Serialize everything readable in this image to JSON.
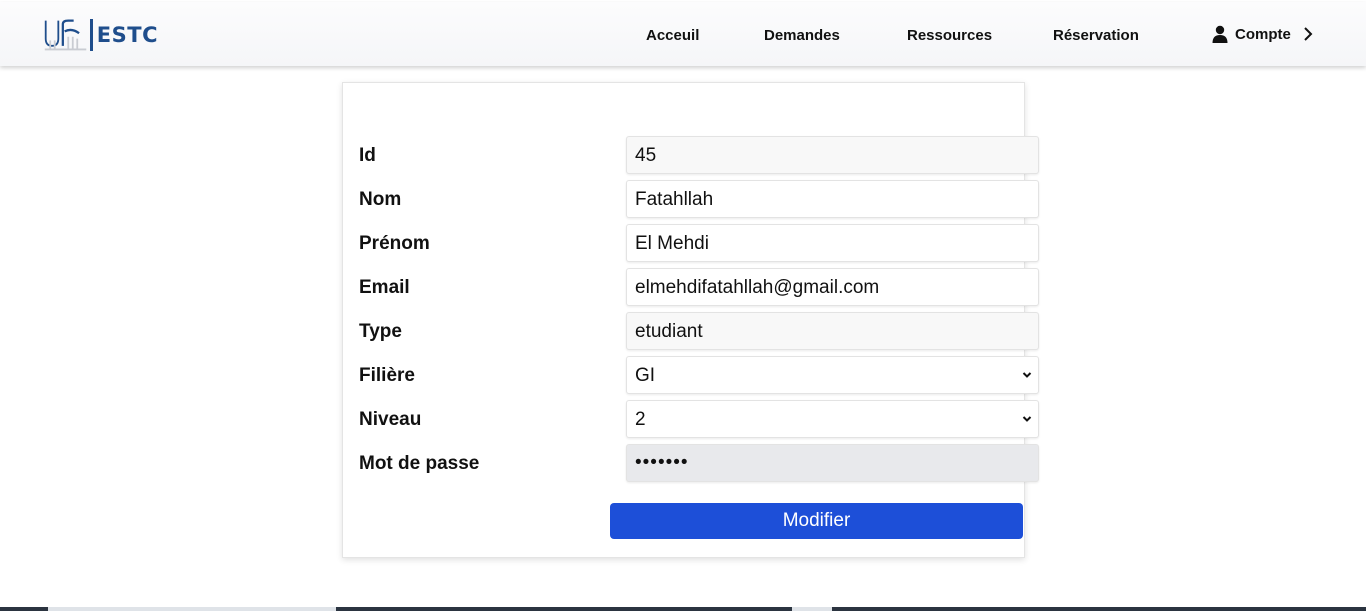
{
  "header": {
    "logo_text": "ESTC",
    "nav": [
      "Acceuil",
      "Demandes",
      "Ressources",
      "Réservation"
    ],
    "account_label": "Compte"
  },
  "form": {
    "fields": [
      {
        "label": "Id",
        "value": "45"
      },
      {
        "label": "Nom",
        "value": "Fatahllah"
      },
      {
        "label": "Prénom",
        "value": "El Mehdi"
      },
      {
        "label": "Email",
        "value": "elmehdifatahllah@gmail.com"
      },
      {
        "label": "Type",
        "value": "etudiant"
      },
      {
        "label": "Filière",
        "value": "GI"
      },
      {
        "label": "Niveau",
        "value": "2"
      },
      {
        "label": "Mot de passe",
        "value": "•••••••"
      }
    ],
    "submit_label": "Modifier"
  },
  "colors": {
    "primary_button": "#1d4fd8",
    "logo_blue": "#1f4e8c"
  }
}
